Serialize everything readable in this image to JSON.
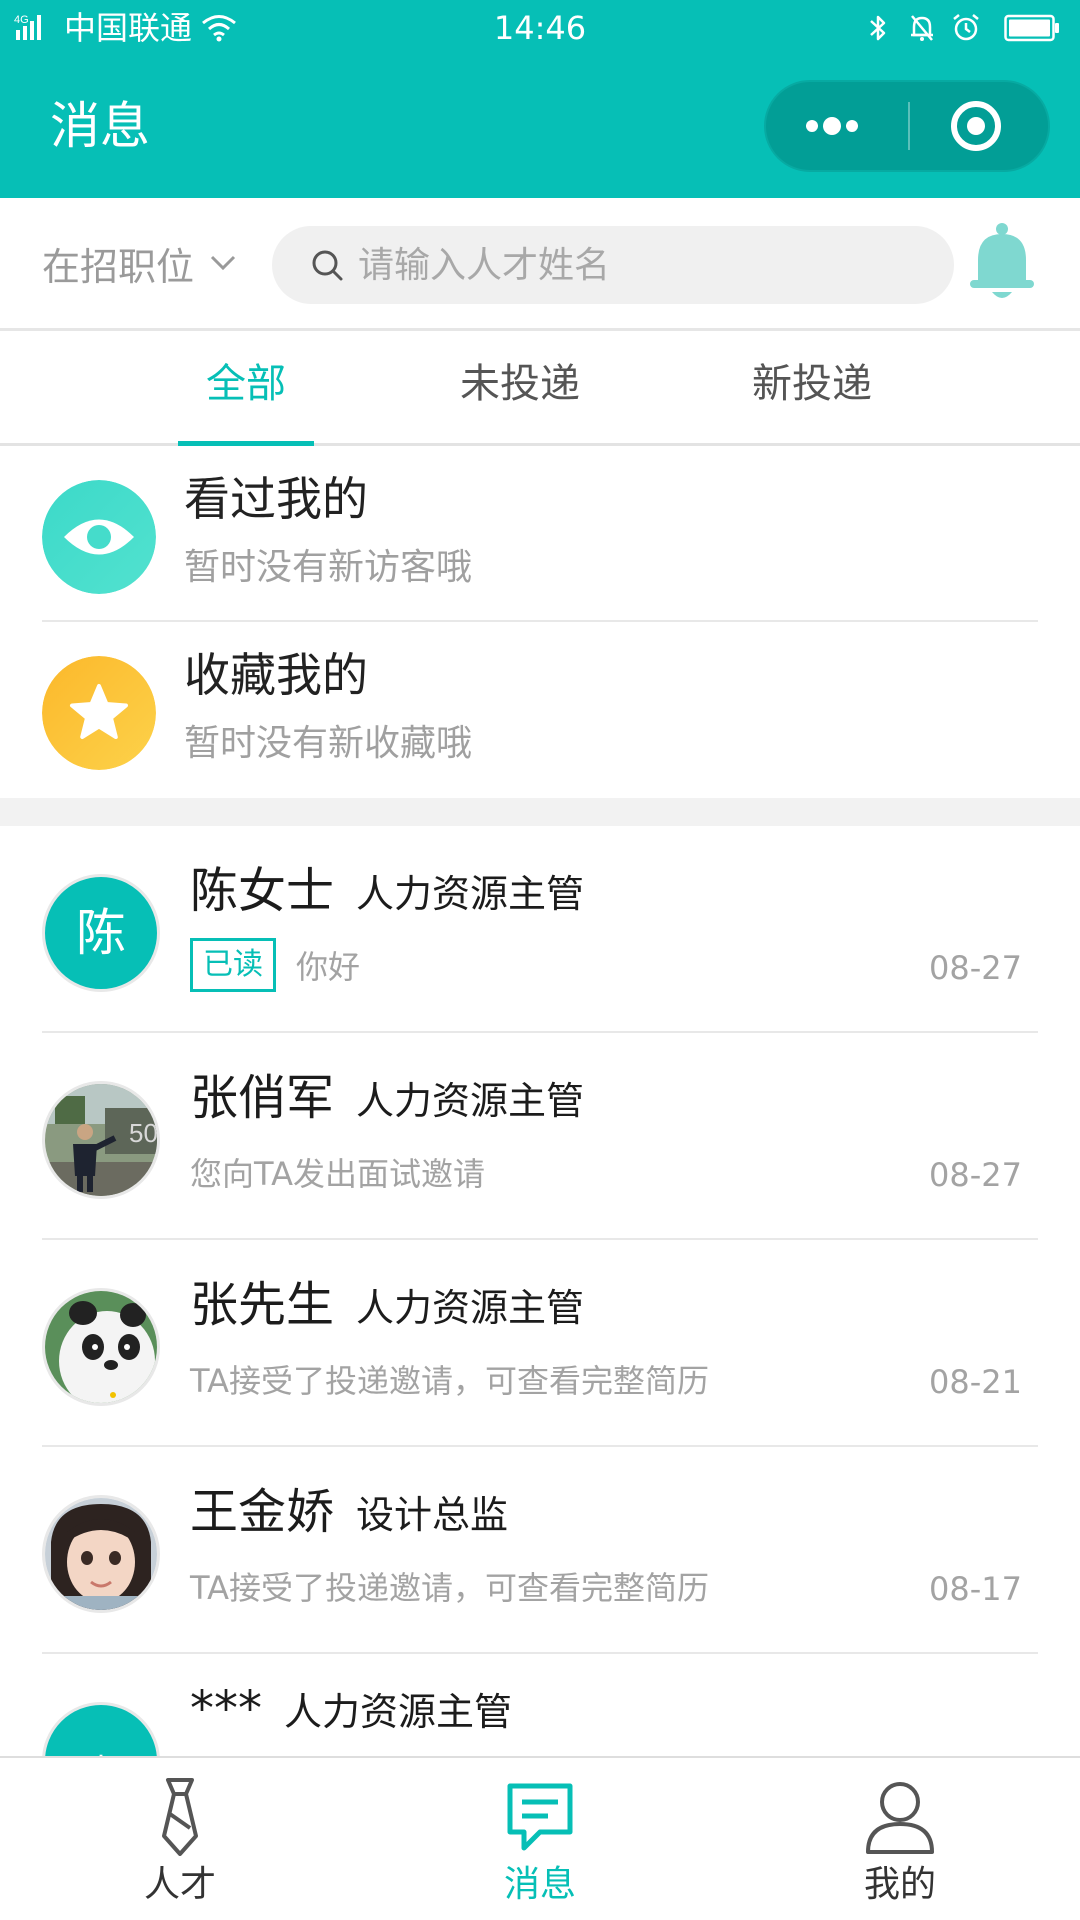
{
  "status_bar": {
    "network": "4G",
    "carrier": "中国联通",
    "time": "14:46"
  },
  "header": {
    "title": "消息",
    "more_icon": "more-dots-icon",
    "close_icon": "target-close-icon"
  },
  "colors": {
    "brand": "#06bfb6",
    "capsule": "#029e96",
    "visitor_icon": "#3fd6c6",
    "favorite_icon": "#fbc02d",
    "bell": "#7fd8d0"
  },
  "search": {
    "filter_label": "在招职位",
    "placeholder": "请输入人才姓名"
  },
  "tabs": [
    {
      "label": "全部",
      "active": true
    },
    {
      "label": "未投递",
      "active": false
    },
    {
      "label": "新投递",
      "active": false
    }
  ],
  "notices": [
    {
      "title": "看过我的",
      "subtitle": "暂时没有新访客哦",
      "icon": "eye-icon"
    },
    {
      "title": "收藏我的",
      "subtitle": "暂时没有新收藏哦",
      "icon": "star-icon"
    }
  ],
  "conversations": [
    {
      "name": "陈女士",
      "job_title": "人力资源主管",
      "avatar_letter": "陈",
      "badge": "已读",
      "preview": "你好",
      "date": "08-27"
    },
    {
      "name": "张俏军",
      "job_title": "人力资源主管",
      "avatar": "avatar-photo-man",
      "preview": "您向TA发出面试邀请",
      "date": "08-27"
    },
    {
      "name": "张先生",
      "job_title": "人力资源主管",
      "avatar": "avatar-panda",
      "preview": "TA接受了投递邀请，可查看完整简历",
      "date": "08-21"
    },
    {
      "name": "王金娇",
      "job_title": "设计总监",
      "avatar": "avatar-photo-girl",
      "preview": "TA接受了投递邀请，可查看完整简历",
      "date": "08-17"
    },
    {
      "name": "***",
      "job_title": "人力资源主管",
      "avatar_letter": "*"
    }
  ],
  "bottom_nav": [
    {
      "label": "人才",
      "icon": "tie-icon",
      "active": false
    },
    {
      "label": "消息",
      "icon": "chat-icon",
      "active": true
    },
    {
      "label": "我的",
      "icon": "person-icon",
      "active": false
    }
  ]
}
